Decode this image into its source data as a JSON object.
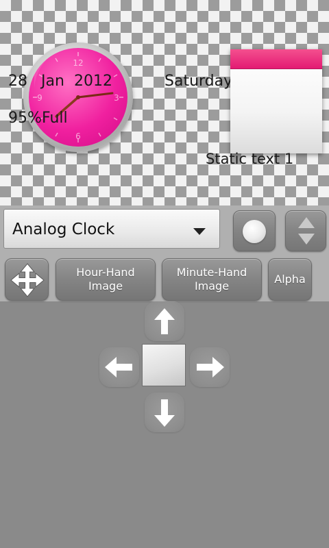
{
  "preview": {
    "clock_numbers": [
      "12",
      "3",
      "6",
      "9"
    ],
    "date_day": "28",
    "date_month": "Jan",
    "date_year": "2012",
    "weekday": "Saturday",
    "battery_percent": "95%",
    "battery_status": "Full",
    "static_text": "Static text 1",
    "accent_color": "#f0209f",
    "calendar_band_color": "#e31a73"
  },
  "toolbar": {
    "widget_select": {
      "selected": "Analog Clock"
    },
    "circle_button_icon": "circle-icon",
    "updown_button_icon": "up-down-arrows-icon",
    "move_button_icon": "move-arrows-icon",
    "hour_hand_label": "Hour-Hand Image",
    "minute_hand_label": "Minute-Hand Image",
    "alpha_label": "Alpha"
  },
  "dpad": {
    "up_icon": "arrow-up-icon",
    "down_icon": "arrow-down-icon",
    "left_icon": "arrow-left-icon",
    "right_icon": "arrow-right-icon"
  }
}
